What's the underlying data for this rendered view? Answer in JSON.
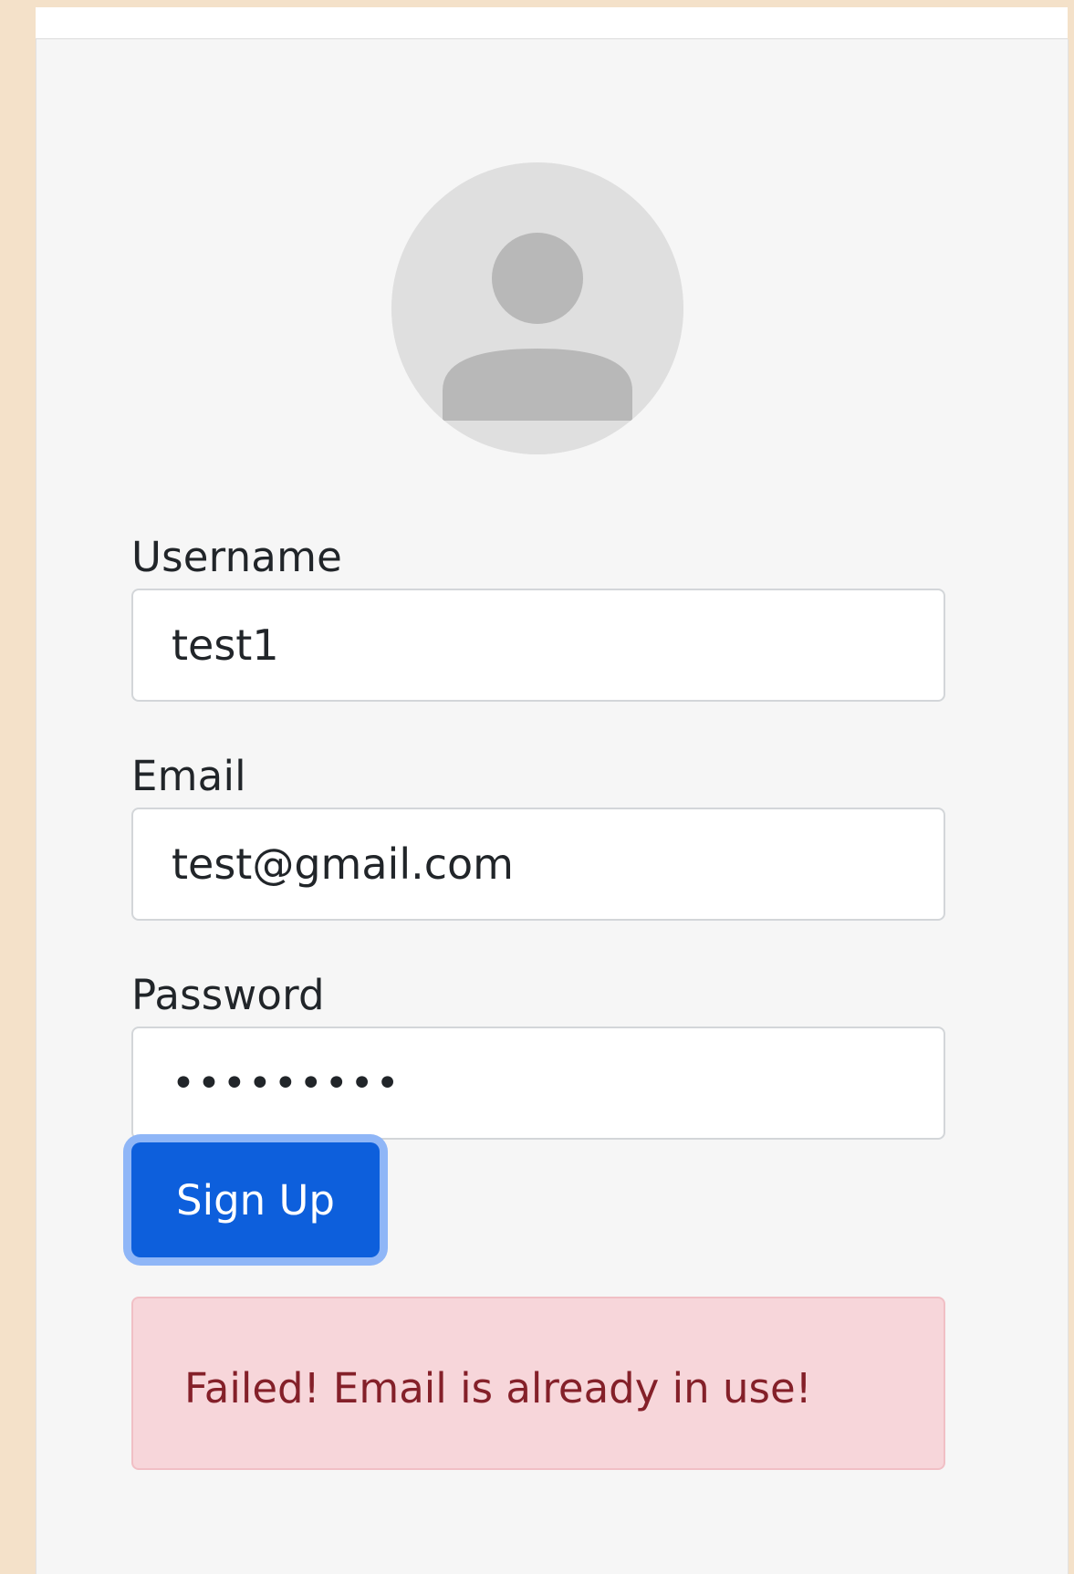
{
  "form": {
    "username_label": "Username",
    "username_value": "test1",
    "email_label": "Email",
    "email_value": "test@gmail.com",
    "password_label": "Password",
    "password_value": "•••••••••",
    "submit_label": "Sign Up"
  },
  "alert": {
    "message": "Failed! Email is already in use!"
  },
  "colors": {
    "page_background": "#f4e1c9",
    "card_background": "#f6f6f6",
    "primary_button": "#0d5fdc",
    "button_focus_ring": "#8fb6f7",
    "alert_background": "#f7d6da",
    "alert_text": "#842029"
  },
  "icons": {
    "avatar": "user-avatar-icon"
  }
}
